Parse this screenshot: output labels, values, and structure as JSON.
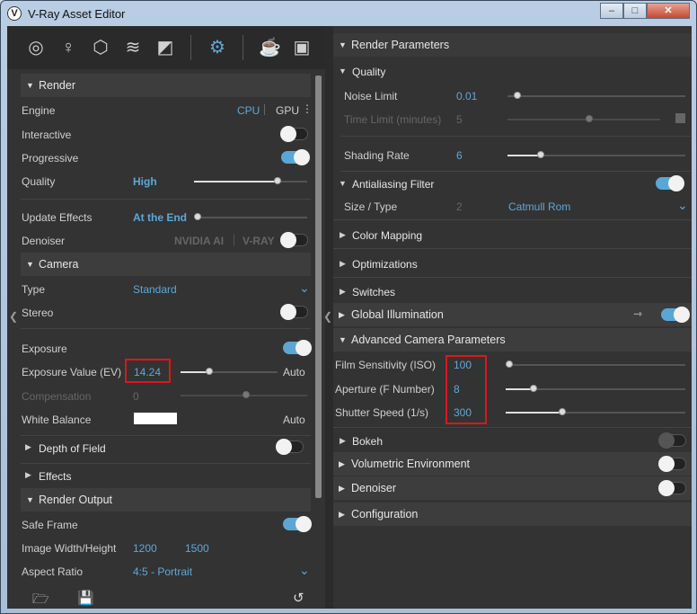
{
  "window": {
    "title": "V-Ray Asset Editor"
  },
  "left": {
    "render": {
      "title": "Render",
      "engine_label": "Engine",
      "cpu": "CPU",
      "gpu": "GPU",
      "interactive": "Interactive",
      "progressive": "Progressive",
      "quality": "Quality",
      "quality_val": "High",
      "update_effects": "Update Effects",
      "update_val": "At the End",
      "denoiser": "Denoiser",
      "nvidia": "NVIDIA AI",
      "vray": "V-RAY"
    },
    "camera": {
      "title": "Camera",
      "type": "Type",
      "type_val": "Standard",
      "stereo": "Stereo",
      "exposure": "Exposure",
      "ev": "Exposure Value (EV)",
      "ev_val": "14.24",
      "auto": "Auto",
      "compensation": "Compensation",
      "comp_val": "0",
      "white_balance": "White Balance",
      "wb_auto": "Auto",
      "dof": "Depth of Field",
      "effects": "Effects"
    },
    "output": {
      "title": "Render Output",
      "safe_frame": "Safe Frame",
      "image_wh": "Image Width/Height",
      "width": "1200",
      "height": "1500",
      "aspect": "Aspect Ratio",
      "aspect_val": "4:5 - Portrait"
    }
  },
  "right": {
    "header": "Render Parameters",
    "quality": {
      "title": "Quality",
      "noise_limit": "Noise Limit",
      "noise_val": "0.01",
      "time_limit": "Time Limit (minutes)",
      "time_val": "5",
      "shading_rate": "Shading Rate",
      "shading_val": "6"
    },
    "aa": {
      "title": "Antialiasing Filter",
      "size_type": "Size / Type",
      "size_val": "2",
      "type_val": "Catmull Rom"
    },
    "sections": {
      "color_mapping": "Color Mapping",
      "optimizations": "Optimizations",
      "switches": "Switches",
      "gi": "Global Illumination",
      "adv_cam": "Advanced Camera Parameters",
      "bokeh": "Bokeh",
      "volumetric": "Volumetric Environment",
      "denoiser": "Denoiser",
      "configuration": "Configuration"
    },
    "adv": {
      "iso": "Film Sensitivity (ISO)",
      "iso_val": "100",
      "aperture": "Aperture (F Number)",
      "aperture_val": "8",
      "shutter": "Shutter Speed (1/s)",
      "shutter_val": "300"
    }
  },
  "colors": {
    "accent": "#5da8d8",
    "highlight": "#e01616"
  }
}
